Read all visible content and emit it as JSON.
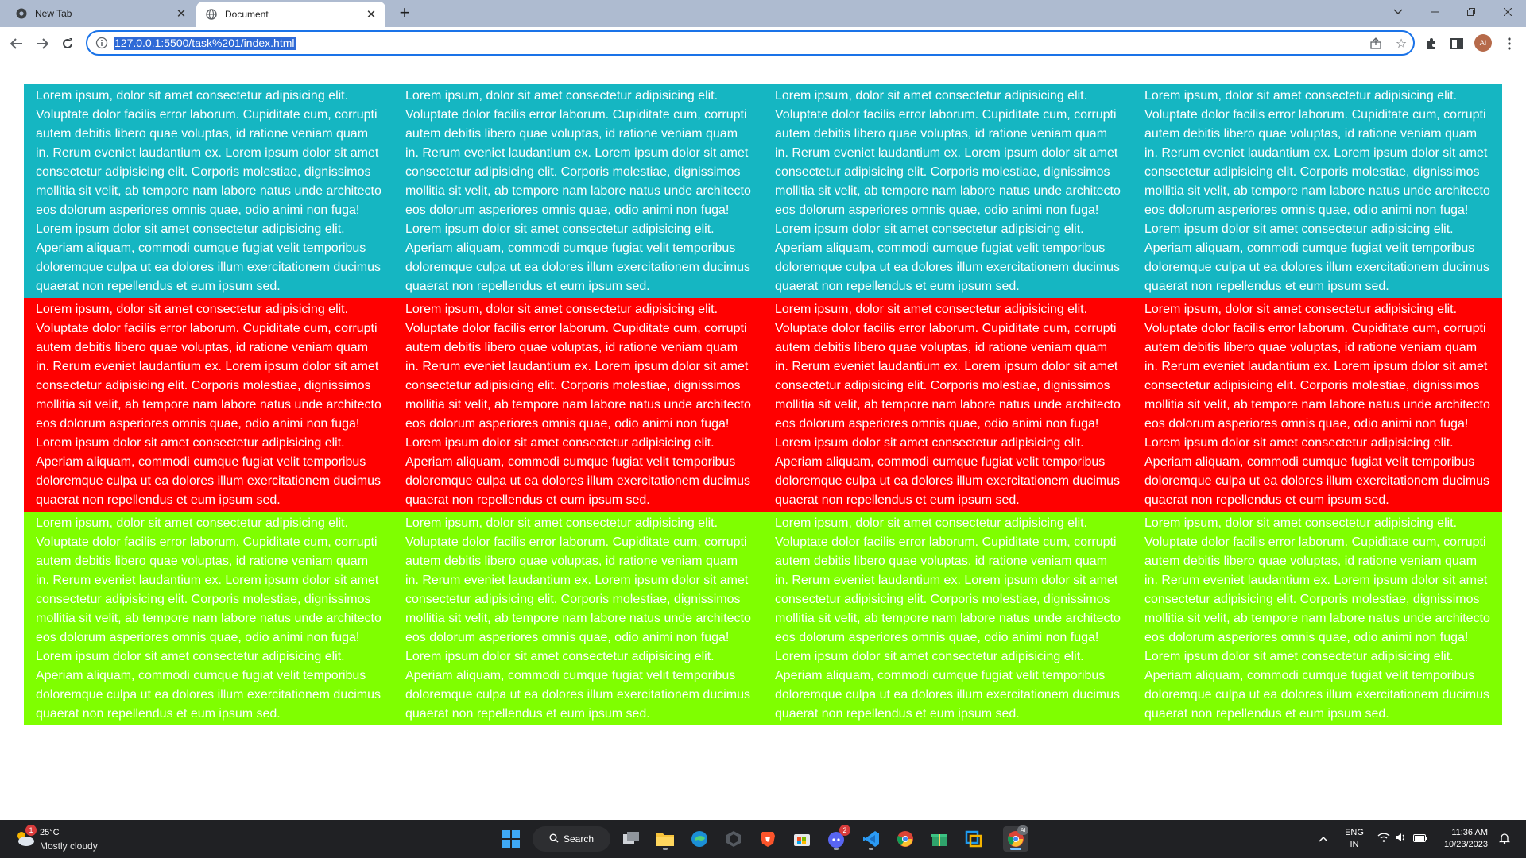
{
  "browser": {
    "tabs": [
      {
        "title": "New Tab",
        "active": false
      },
      {
        "title": "Document",
        "active": true
      }
    ],
    "new_tab_glyph": "+",
    "window_controls": [
      "tab-search-chevron-icon",
      "minimize-icon",
      "restore-icon",
      "close-icon"
    ],
    "url": "127.0.0.1:5500/task%201/index.html",
    "profile_initials": "AI"
  },
  "page": {
    "paragraph": "Lorem ipsum, dolor sit amet consectetur adipisicing elit. Voluptate dolor facilis error laborum. Cupiditate cum, corrupti autem debitis libero quae voluptas, id ratione veniam quam in. Rerum eveniet laudantium ex. Lorem ipsum dolor sit amet consectetur adipisicing elit. Corporis molestiae, dignissimos mollitia sit velit, ab tempore nam labore natus unde architecto eos dolorum asperiores omnis quae, odio animi non fuga! Lorem ipsum dolor sit amet consectetur adipisicing elit. Aperiam aliquam, commodi cumque fugiat velit temporibus doloremque culpa ut ea dolores illum exercitationem ducimus quaerat non repellendus et eum ipsum sed.",
    "rows": [
      {
        "color": "#15b6c2",
        "name": "cyan"
      },
      {
        "color": "#ff0000",
        "name": "red"
      },
      {
        "color": "#7fff00",
        "name": "green"
      }
    ],
    "columns_per_row": 4,
    "text_color": "#ffffff"
  },
  "taskbar": {
    "weather": {
      "temp": "25°C",
      "condition": "Mostly cloudy",
      "badge": "1"
    },
    "search_label": "Search",
    "discord_badge": "2",
    "tray": {
      "language": "ENG",
      "region": "IN"
    },
    "clock": {
      "time": "11:36 AM",
      "date": "10/23/2023"
    }
  }
}
